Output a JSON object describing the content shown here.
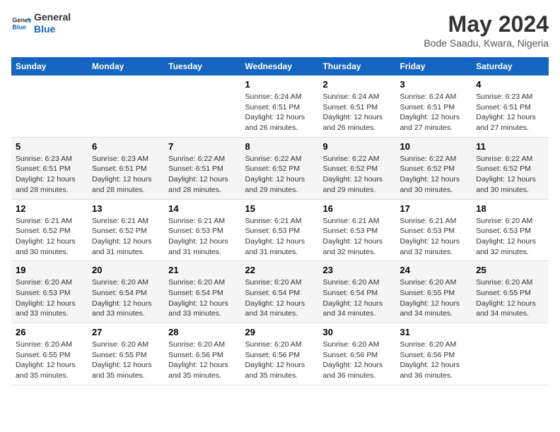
{
  "logo": {
    "line1": "General",
    "line2": "Blue"
  },
  "title": "May 2024",
  "subtitle": "Bode Saadu, Kwara, Nigeria",
  "days_of_week": [
    "Sunday",
    "Monday",
    "Tuesday",
    "Wednesday",
    "Thursday",
    "Friday",
    "Saturday"
  ],
  "weeks": [
    [
      {
        "day": "",
        "info": ""
      },
      {
        "day": "",
        "info": ""
      },
      {
        "day": "",
        "info": ""
      },
      {
        "day": "1",
        "info": "Sunrise: 6:24 AM\nSunset: 6:51 PM\nDaylight: 12 hours and 26 minutes."
      },
      {
        "day": "2",
        "info": "Sunrise: 6:24 AM\nSunset: 6:51 PM\nDaylight: 12 hours and 26 minutes."
      },
      {
        "day": "3",
        "info": "Sunrise: 6:24 AM\nSunset: 6:51 PM\nDaylight: 12 hours and 27 minutes."
      },
      {
        "day": "4",
        "info": "Sunrise: 6:23 AM\nSunset: 6:51 PM\nDaylight: 12 hours and 27 minutes."
      }
    ],
    [
      {
        "day": "5",
        "info": "Sunrise: 6:23 AM\nSunset: 6:51 PM\nDaylight: 12 hours and 28 minutes."
      },
      {
        "day": "6",
        "info": "Sunrise: 6:23 AM\nSunset: 6:51 PM\nDaylight: 12 hours and 28 minutes."
      },
      {
        "day": "7",
        "info": "Sunrise: 6:22 AM\nSunset: 6:51 PM\nDaylight: 12 hours and 28 minutes."
      },
      {
        "day": "8",
        "info": "Sunrise: 6:22 AM\nSunset: 6:52 PM\nDaylight: 12 hours and 29 minutes."
      },
      {
        "day": "9",
        "info": "Sunrise: 6:22 AM\nSunset: 6:52 PM\nDaylight: 12 hours and 29 minutes."
      },
      {
        "day": "10",
        "info": "Sunrise: 6:22 AM\nSunset: 6:52 PM\nDaylight: 12 hours and 30 minutes."
      },
      {
        "day": "11",
        "info": "Sunrise: 6:22 AM\nSunset: 6:52 PM\nDaylight: 12 hours and 30 minutes."
      }
    ],
    [
      {
        "day": "12",
        "info": "Sunrise: 6:21 AM\nSunset: 6:52 PM\nDaylight: 12 hours and 30 minutes."
      },
      {
        "day": "13",
        "info": "Sunrise: 6:21 AM\nSunset: 6:52 PM\nDaylight: 12 hours and 31 minutes."
      },
      {
        "day": "14",
        "info": "Sunrise: 6:21 AM\nSunset: 6:53 PM\nDaylight: 12 hours and 31 minutes."
      },
      {
        "day": "15",
        "info": "Sunrise: 6:21 AM\nSunset: 6:53 PM\nDaylight: 12 hours and 31 minutes."
      },
      {
        "day": "16",
        "info": "Sunrise: 6:21 AM\nSunset: 6:53 PM\nDaylight: 12 hours and 32 minutes."
      },
      {
        "day": "17",
        "info": "Sunrise: 6:21 AM\nSunset: 6:53 PM\nDaylight: 12 hours and 32 minutes."
      },
      {
        "day": "18",
        "info": "Sunrise: 6:20 AM\nSunset: 6:53 PM\nDaylight: 12 hours and 32 minutes."
      }
    ],
    [
      {
        "day": "19",
        "info": "Sunrise: 6:20 AM\nSunset: 6:53 PM\nDaylight: 12 hours and 33 minutes."
      },
      {
        "day": "20",
        "info": "Sunrise: 6:20 AM\nSunset: 6:54 PM\nDaylight: 12 hours and 33 minutes."
      },
      {
        "day": "21",
        "info": "Sunrise: 6:20 AM\nSunset: 6:54 PM\nDaylight: 12 hours and 33 minutes."
      },
      {
        "day": "22",
        "info": "Sunrise: 6:20 AM\nSunset: 6:54 PM\nDaylight: 12 hours and 34 minutes."
      },
      {
        "day": "23",
        "info": "Sunrise: 6:20 AM\nSunset: 6:54 PM\nDaylight: 12 hours and 34 minutes."
      },
      {
        "day": "24",
        "info": "Sunrise: 6:20 AM\nSunset: 6:55 PM\nDaylight: 12 hours and 34 minutes."
      },
      {
        "day": "25",
        "info": "Sunrise: 6:20 AM\nSunset: 6:55 PM\nDaylight: 12 hours and 34 minutes."
      }
    ],
    [
      {
        "day": "26",
        "info": "Sunrise: 6:20 AM\nSunset: 6:55 PM\nDaylight: 12 hours and 35 minutes."
      },
      {
        "day": "27",
        "info": "Sunrise: 6:20 AM\nSunset: 6:55 PM\nDaylight: 12 hours and 35 minutes."
      },
      {
        "day": "28",
        "info": "Sunrise: 6:20 AM\nSunset: 6:56 PM\nDaylight: 12 hours and 35 minutes."
      },
      {
        "day": "29",
        "info": "Sunrise: 6:20 AM\nSunset: 6:56 PM\nDaylight: 12 hours and 35 minutes."
      },
      {
        "day": "30",
        "info": "Sunrise: 6:20 AM\nSunset: 6:56 PM\nDaylight: 12 hours and 36 minutes."
      },
      {
        "day": "31",
        "info": "Sunrise: 6:20 AM\nSunset: 6:56 PM\nDaylight: 12 hours and 36 minutes."
      },
      {
        "day": "",
        "info": ""
      }
    ]
  ]
}
